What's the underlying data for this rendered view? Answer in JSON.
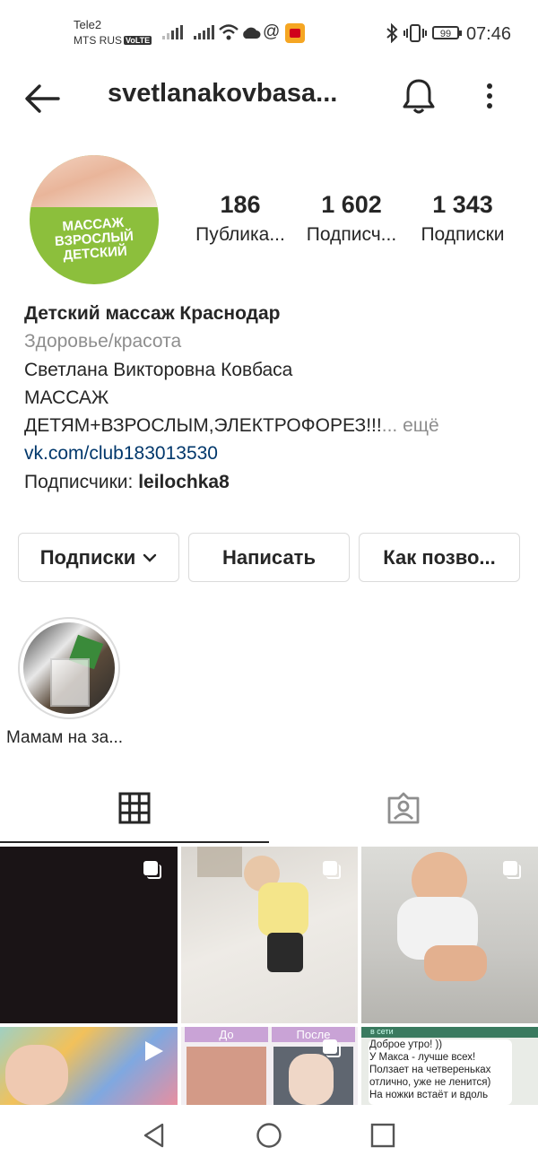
{
  "status_bar": {
    "carrier_top": "Tele2",
    "carrier_bottom": "MTS RUS",
    "volte": "VoLTE",
    "battery": "99",
    "time": "07:46"
  },
  "header": {
    "username": "svetlanakovbasa..."
  },
  "profile": {
    "avatar_text": [
      "МАССАЖ",
      "ВЗРОСЛЫЙ",
      "ДЕТСКИЙ"
    ],
    "stats": [
      {
        "value": "186",
        "label": "Публика..."
      },
      {
        "value": "1 602",
        "label": "Подписч..."
      },
      {
        "value": "1 343",
        "label": "Подписки"
      }
    ],
    "name": "Детский массаж Краснодар",
    "category": "Здоровье/красота",
    "bio_line1": "Светлана Викторовна Ковбаса",
    "bio_line2": "МАССАЖ",
    "bio_line3": "ДЕТЯМ+ВЗРОСЛЫМ,ЭЛЕКТРОФОРЕЗ!!!",
    "more": "... ещё",
    "link": "vk.com/club183013530",
    "followers_prefix": "Подписчики: ",
    "followers_user": "leilochka8"
  },
  "buttons": {
    "following": "Подписки",
    "message": "Написать",
    "contact": "Как позво..."
  },
  "highlights": [
    {
      "label": "Мамам на за..."
    }
  ],
  "grid": {
    "before_label": "До",
    "after_label": "После",
    "chat_status": "в сети",
    "chat_lines": [
      "Доброе утро! ))",
      "У Макса - лучше всех!",
      "Ползает на четвереньках",
      "отлично, уже не ленится)",
      "На ножки встаёт и вдоль"
    ]
  },
  "colors": {
    "text": "#262626",
    "secondary": "#8e8e8e",
    "link": "#00376b",
    "border": "#dbdbdb",
    "avatar_green": "#8cbf3c"
  }
}
